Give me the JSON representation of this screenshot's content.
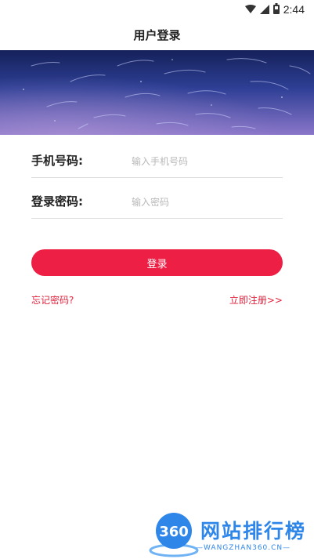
{
  "status_bar": {
    "time": "2:44",
    "icons": [
      "wifi-icon",
      "signal-icon",
      "battery-icon"
    ]
  },
  "header": {
    "title": "用户登录"
  },
  "login_form": {
    "phone_label": "手机号码:",
    "phone_placeholder": "输入手机号码",
    "phone_value": "",
    "password_label": "登录密码:",
    "password_placeholder": "输入密码",
    "password_value": "",
    "login_button_label": "登录",
    "forgot_password_link": "忘记密码?",
    "register_link": "立即注册>>"
  },
  "watermark": {
    "logo_text": "360",
    "title": "网站排行榜",
    "subtitle": "—WANGZHAN360.CN—"
  },
  "colors": {
    "accent": "#ee1f45",
    "link": "#e3213c",
    "watermark": "#2f86e9",
    "banner_top": "#1b2a6b",
    "banner_bottom": "#7a6ec8"
  }
}
